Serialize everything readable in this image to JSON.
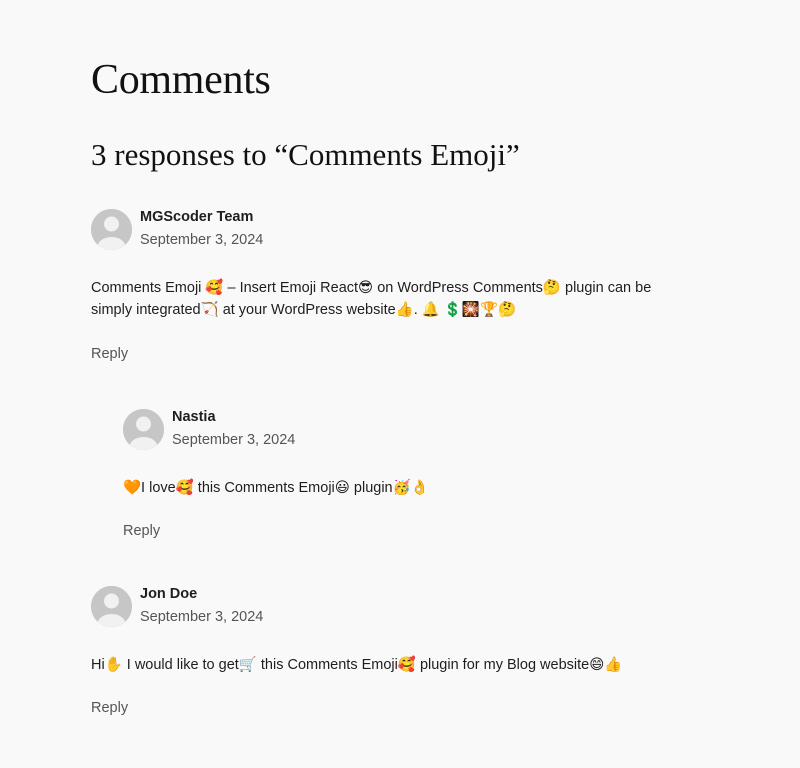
{
  "page": {
    "heading": "Comments",
    "responses_title": "3 responses to “Comments Emoji”"
  },
  "comments": [
    {
      "author": "MGScoder Team",
      "date": "September 3, 2024",
      "text": "Comments Emoji 🥰 – Insert Emoji React😎 on WordPress Comments🤔 plugin can be simply integrated🏹 at your WordPress website👍. 🔔 💲🎇🏆🤔",
      "reply_label": "Reply",
      "avatar_icon": "default-avatar-icon"
    },
    {
      "author": "Nastia",
      "date": "September 3, 2024",
      "text": "🧡I love🥰 this Comments Emoji😃 plugin🥳👌",
      "reply_label": "Reply",
      "avatar_icon": "default-avatar-icon"
    },
    {
      "author": "Jon Doe",
      "date": "September 3, 2024",
      "text": "Hi✋ I would like to get🛒 this Comments Emoji🥰 plugin for my Blog website😄👍",
      "reply_label": "Reply",
      "avatar_icon": "default-avatar-icon"
    }
  ]
}
